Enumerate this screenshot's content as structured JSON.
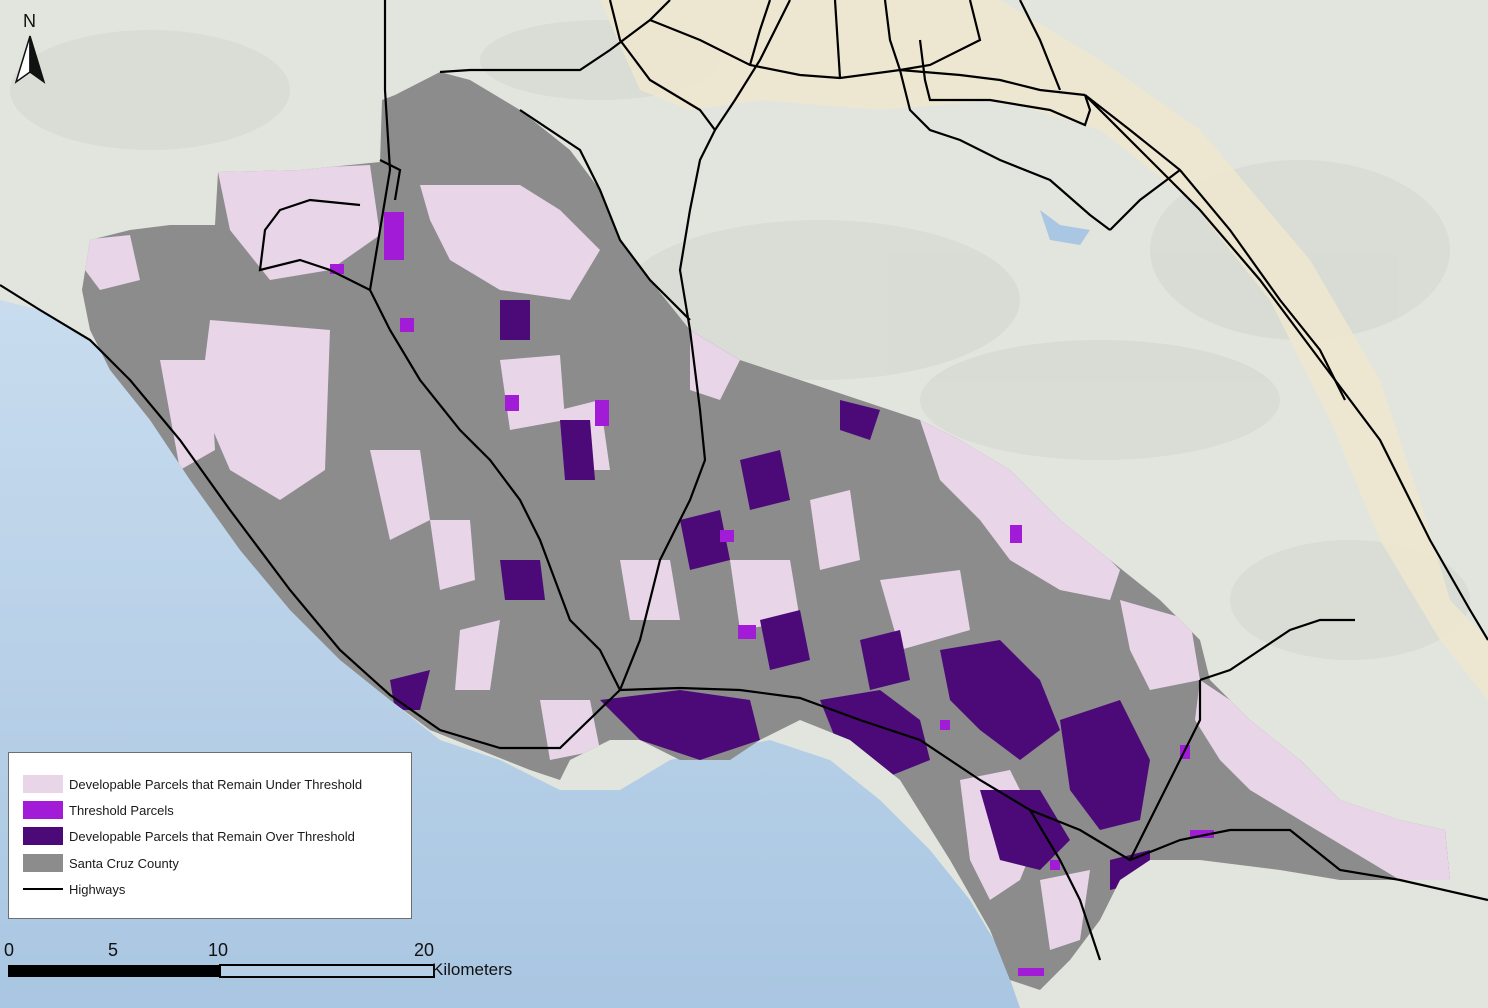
{
  "legend": {
    "items": [
      {
        "label": "Developable Parcels that Remain Under Threshold",
        "color": "#e8d5e8",
        "kind": "fill"
      },
      {
        "label": "Threshold Parcels",
        "color": "#a21bd6",
        "kind": "fill"
      },
      {
        "label": "Developable Parcels that Remain Over Threshold",
        "color": "#4b0a78",
        "kind": "fill"
      },
      {
        "label": "Santa Cruz County",
        "color": "#8c8c8c",
        "kind": "fill"
      },
      {
        "label": "Highways",
        "color": "#000000",
        "kind": "line"
      }
    ]
  },
  "north_arrow": {
    "letter": "N"
  },
  "scale_bar": {
    "ticks": [
      "0",
      "5",
      "10",
      "20"
    ],
    "unit": "Kilometers"
  },
  "colors": {
    "ocean": "#b9d3e8",
    "land": "#dfe3dc",
    "urban": "#efe8cf",
    "county": "#8c8c8c"
  }
}
